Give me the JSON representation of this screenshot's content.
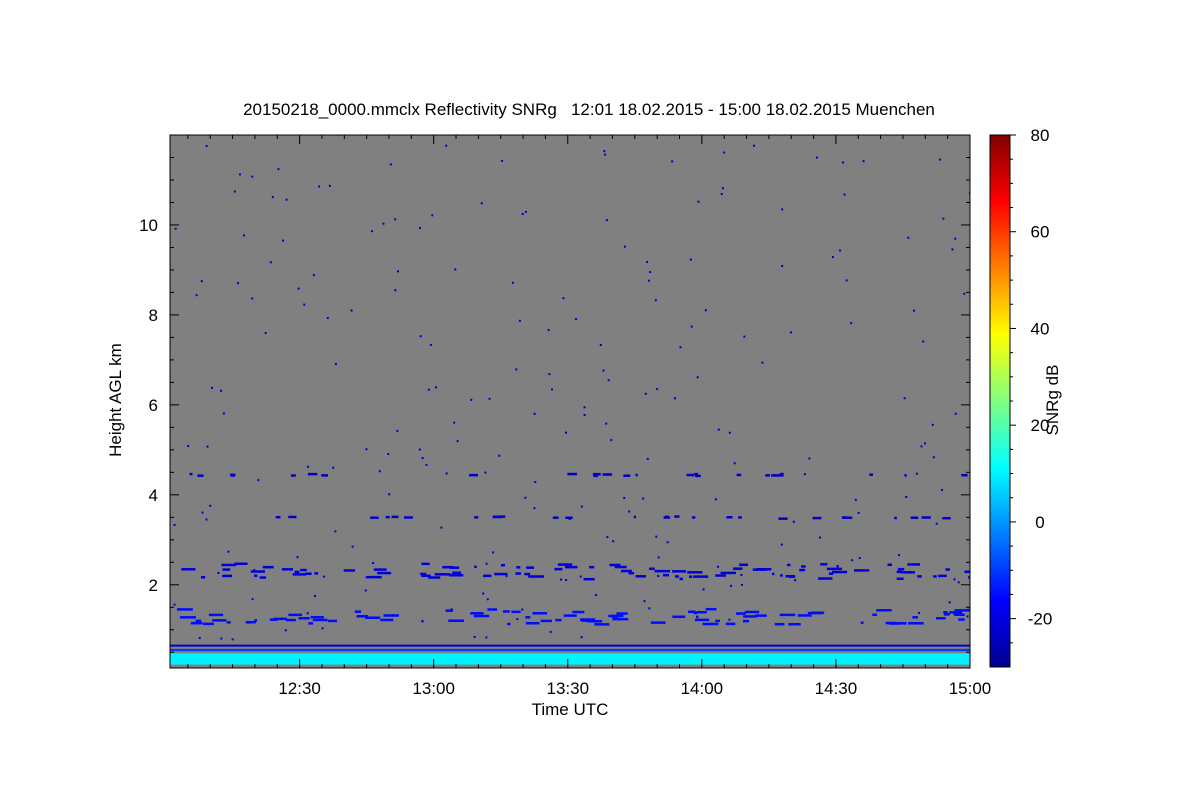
{
  "chart_data": {
    "type": "heatmap",
    "title": "20150218_0000.mmclx Reflectivity SNRg   12:01 18.02.2015 - 15:00 18.02.2015 Muenchen",
    "xlabel": "Time UTC",
    "ylabel": "Height AGL km",
    "x_ticks": [
      "12:30",
      "13:00",
      "13:30",
      "14:00",
      "14:30",
      "15:00"
    ],
    "x_tick_minutes": [
      30,
      60,
      90,
      120,
      150,
      180
    ],
    "xlim_minutes": [
      1,
      180
    ],
    "y_ticks": [
      "2",
      "4",
      "6",
      "8",
      "10"
    ],
    "y_tick_values": [
      2,
      4,
      6,
      8,
      10
    ],
    "ylim": [
      0.15,
      12.0
    ],
    "background_color": "#808080",
    "colorbar": {
      "label": "SNRg dB",
      "ticks": [
        "-20",
        "0",
        "20",
        "40",
        "60",
        "80"
      ],
      "tick_values": [
        -20,
        0,
        20,
        40,
        60,
        80
      ],
      "range": [
        -30,
        80
      ],
      "colormap": "jet"
    },
    "echo_layers": [
      {
        "height_km": 0.35,
        "thickness_km": 0.25,
        "snr_db": 10,
        "coverage": "continuous"
      },
      {
        "height_km": 0.55,
        "thickness_km": 0.05,
        "snr_db": -10,
        "coverage": "continuous"
      },
      {
        "height_km": 0.65,
        "thickness_km": 0.04,
        "snr_db": -22,
        "coverage": "continuous"
      },
      {
        "height_km": 1.3,
        "snr_db": -15,
        "coverage": "intermittent"
      },
      {
        "height_km": 2.3,
        "snr_db": -20,
        "coverage": "intermittent"
      },
      {
        "height_km": 3.5,
        "snr_db": -22,
        "coverage": "sparse"
      },
      {
        "height_km": 4.45,
        "snr_db": -22,
        "coverage": "sparse"
      }
    ]
  }
}
